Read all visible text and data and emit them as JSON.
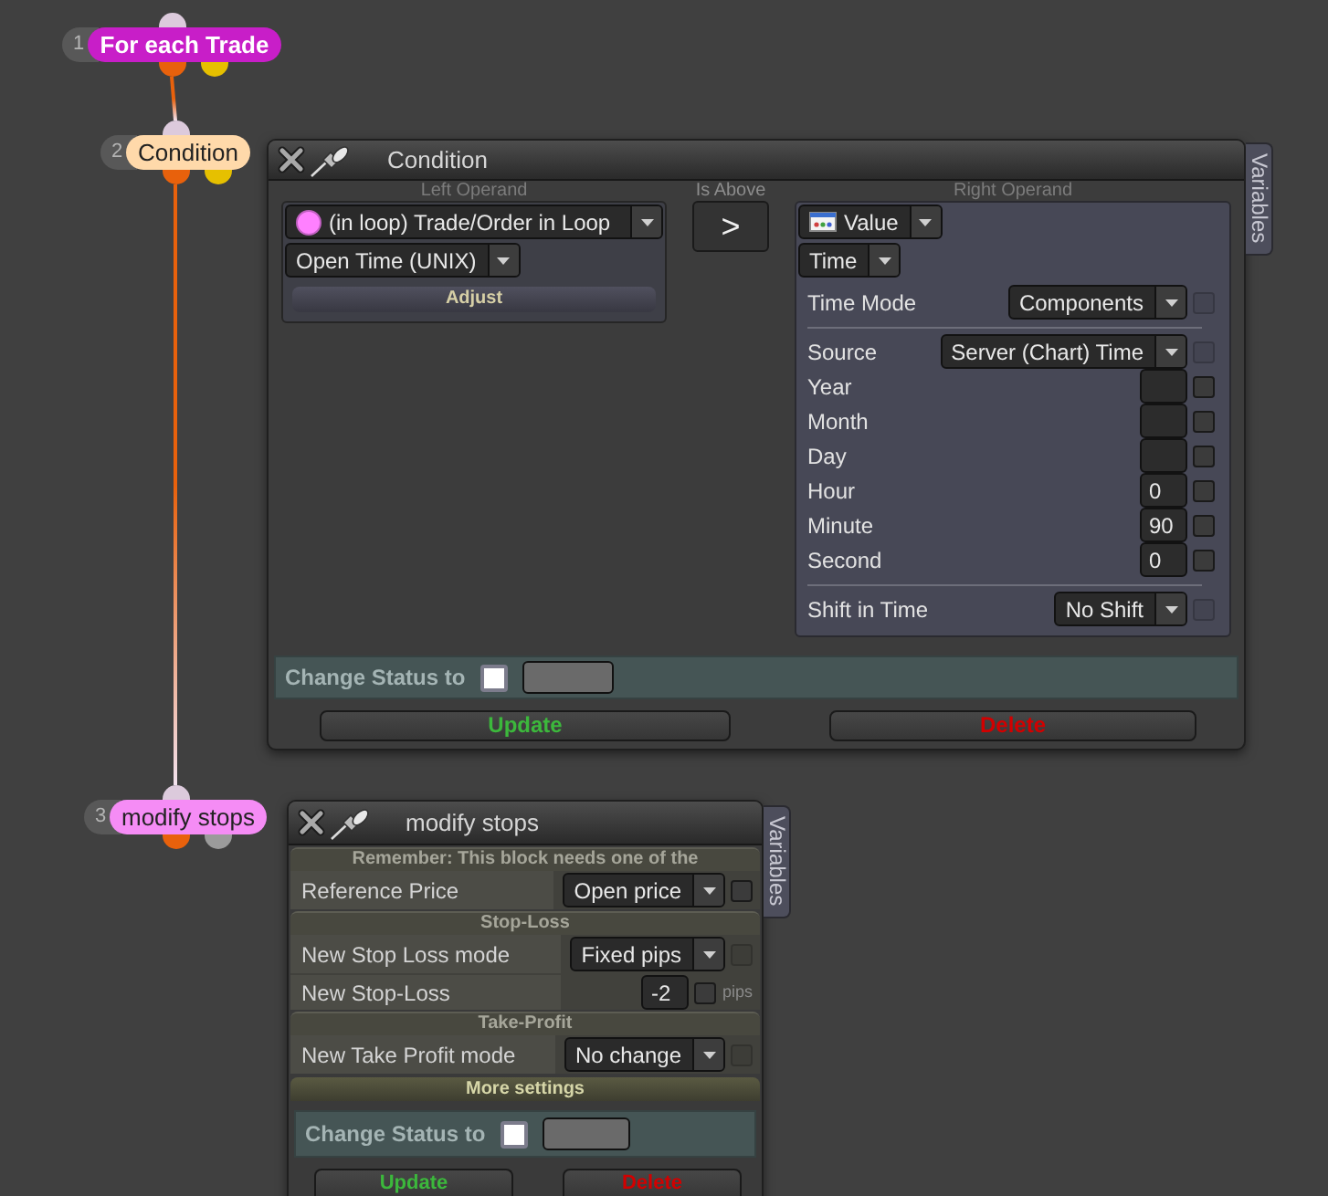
{
  "nodes": [
    {
      "number": "1",
      "label": "For each Trade",
      "color": "#c81ec8",
      "outputs": [
        {
          "color": "#e8610c",
          "connected": true
        },
        {
          "color": "#e6c000",
          "connected": false
        }
      ]
    },
    {
      "number": "2",
      "label": "Condition",
      "color": "#ffd9aa",
      "outputs": [
        {
          "color": "#e8610c",
          "connected": true
        },
        {
          "color": "#e6c000",
          "connected": false
        }
      ]
    },
    {
      "number": "3",
      "label": "modify stops",
      "color": "#f58cf5",
      "outputs": [
        {
          "color": "#e8610c",
          "connected": false
        },
        {
          "color": "#9b9b9b",
          "connected": false
        }
      ]
    }
  ],
  "condition_panel": {
    "title": "Condition",
    "side_tab": "Variables",
    "left_operand": {
      "label": "Left Operand",
      "source": "(in loop) Trade/Order in Loop",
      "field": "Open Time (UNIX)",
      "button": "Adjust"
    },
    "operator": {
      "label": "Is Above",
      "symbol": ">"
    },
    "right_operand": {
      "label": "Right Operand",
      "type": "Value",
      "subtype": "Time",
      "groups": [
        {
          "rows": [
            {
              "kind": "select",
              "label": "Time Mode",
              "value": "Components",
              "checkbox": {
                "checked": false,
                "disabled": true
              }
            }
          ]
        },
        {
          "rows": [
            {
              "kind": "select",
              "label": "Source",
              "value": "Server (Chart) Time",
              "checkbox": {
                "checked": false,
                "disabled": true
              }
            },
            {
              "kind": "number",
              "label": "Year",
              "checkbox": {
                "checked": false,
                "disabled": false
              }
            },
            {
              "kind": "number",
              "label": "Month",
              "checkbox": {
                "checked": false,
                "disabled": false
              }
            },
            {
              "kind": "number",
              "label": "Day",
              "checkbox": {
                "checked": false,
                "disabled": false
              }
            },
            {
              "kind": "number",
              "label": "Hour",
              "value": "0",
              "checkbox": {
                "checked": false,
                "disabled": false
              }
            },
            {
              "kind": "number",
              "label": "Minute",
              "value": "90",
              "checkbox": {
                "checked": false,
                "disabled": false
              }
            },
            {
              "kind": "number",
              "label": "Second",
              "value": "0",
              "checkbox": {
                "checked": false,
                "disabled": false
              }
            }
          ]
        },
        {
          "rows": [
            {
              "kind": "select",
              "label": "Shift in Time",
              "value": "No Shift",
              "checkbox": {
                "checked": false,
                "disabled": true
              }
            }
          ]
        }
      ]
    },
    "status": {
      "label": "Change Status to",
      "checked": false
    },
    "buttons": [
      {
        "kind": "update",
        "label": "Update"
      },
      {
        "kind": "delete",
        "label": "Delete"
      }
    ]
  },
  "modify_panel": {
    "title": "modify stops",
    "side_tab": "Variables",
    "sections": [
      {
        "heading": "Remember: This block needs one of the",
        "rows": [
          {
            "kind": "select",
            "label": "Reference Price",
            "value": "Open price",
            "checkbox": {
              "checked": false,
              "disabled": false
            }
          }
        ]
      },
      {
        "heading": "Stop-Loss",
        "rows": [
          {
            "kind": "select",
            "label": "New Stop Loss mode",
            "value": "Fixed pips",
            "checkbox": {
              "checked": false,
              "disabled": true
            }
          },
          {
            "kind": "number",
            "label": "New Stop-Loss",
            "value": "-2",
            "unit": "pips",
            "checkbox": {
              "checked": false,
              "disabled": false
            }
          }
        ]
      },
      {
        "heading": "Take-Profit",
        "rows": [
          {
            "kind": "select",
            "label": "New Take Profit mode",
            "value": "No change",
            "checkbox": {
              "checked": false,
              "disabled": true
            }
          }
        ]
      }
    ],
    "more_button": "More settings",
    "status": {
      "label": "Change Status to",
      "checked": false
    },
    "buttons": [
      {
        "kind": "update",
        "label": "Update"
      },
      {
        "kind": "delete",
        "label": "Delete"
      }
    ]
  }
}
